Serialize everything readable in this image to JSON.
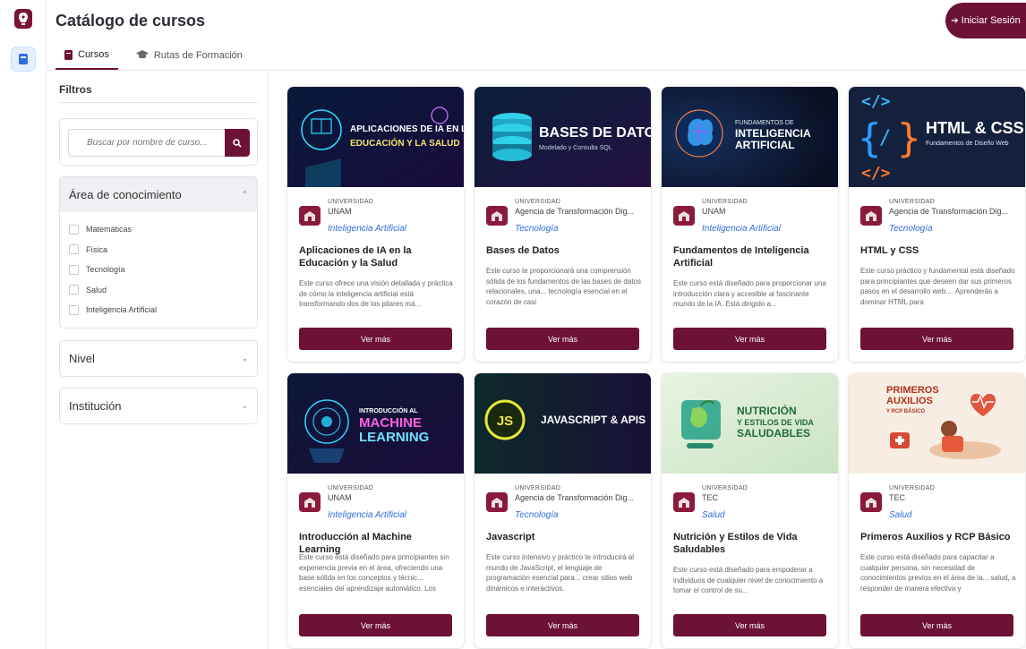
{
  "header": {
    "title": "Catálogo de cursos",
    "login_label": "Iniciar Sesión"
  },
  "tabs": [
    {
      "label": "Cursos",
      "icon": "book-icon",
      "active": true
    },
    {
      "label": "Rutas de Formación",
      "icon": "graduation-cap-icon",
      "active": false
    }
  ],
  "filters": {
    "title": "Filtros",
    "search": {
      "placeholder": "Buscar por nombre de curso...",
      "value": ""
    },
    "sections": [
      {
        "label": "Área de conocimiento",
        "expanded": true,
        "options": [
          "Matemáticas",
          "Física",
          "Tecnología",
          "Salud",
          "Inteligencia Artificial"
        ]
      },
      {
        "label": "Nivel",
        "expanded": false
      },
      {
        "label": "Institución",
        "expanded": false
      }
    ]
  },
  "colors": {
    "brand": "#6d1236",
    "accent_blue": "#2f6ed8"
  },
  "courses": [
    {
      "image_title": "APLICACIONES DE IA EN LA",
      "image_title2": "EDUCACIÓN Y LA SALUD",
      "institution_type": "UNIVERSIDAD",
      "institution": "UNAM",
      "area": "Inteligencia Artificial",
      "title": "Aplicaciones de IA en la Educación y la Salud",
      "description": "Este curso ofrece una visión detallada y práctica de cómo la inteligencia artificial está transformando dos de los pilares má...",
      "button": "Ver más"
    },
    {
      "image_title": "BASES DE DATOS",
      "image_subtitle": "Modelado y Consulta SQL",
      "institution_type": "UNIVERSIDAD",
      "institution": "Agencia de Transformación Dig...",
      "area": "Tecnología",
      "title": "Bases de Datos",
      "description": "Este curso te proporcionará una comprensión sólida de los fundamentos de las bases de datos relacionales, una... tecnología esencial en el corazón de casi",
      "button": "Ver más"
    },
    {
      "image_title": "FUNDAMENTOS DE",
      "image_title2": "INTELIGENCIA",
      "image_title3": "ARTIFICIAL",
      "institution_type": "UNIVERSIDAD",
      "institution": "UNAM",
      "area": "Inteligencia Artificial",
      "title": "Fundamentos de Inteligencia Artificial",
      "description": "Este curso está diseñado para proporcionar una introducción clara y accesible al fascinante mundo de la IA. Está dirigido a...",
      "button": "Ver más"
    },
    {
      "image_title": "HTML & CSS",
      "image_subtitle": "Fundamentos de Diseño Web",
      "institution_type": "UNIVERSIDAD",
      "institution": "Agencia de Transformación Dig...",
      "area": "Tecnología",
      "title": "HTML y CSS",
      "description": "Este curso práctico y fundamental está diseñado para principiantes que deseen dar sus primeros pasos en el desarrollo web.... Aprenderás a dominar HTML para",
      "button": "Ver más"
    },
    {
      "image_title": "INTRODUCCIÓN AL",
      "image_title2": "MACHINE",
      "image_title3": "LEARNING",
      "institution_type": "UNIVERSIDAD",
      "institution": "UNAM",
      "area": "Inteligencia Artificial",
      "title": "Introducción al Machine Learning",
      "description": "Este curso está diseñado para principiantes sin experiencia previa en el área, ofreciendo una base sólida en los conceptos y técnic... esenciales del aprendizaje automático. Los",
      "button": "Ver más"
    },
    {
      "image_title": "JAVASCRIPT & APIS",
      "image_badge": "JS",
      "institution_type": "UNIVERSIDAD",
      "institution": "Agencia de Transformación Dig...",
      "area": "Tecnología",
      "title": "Javascript",
      "description": "Este curso intensivo y práctico te introducirá al mundo de JavaScript, el lenguaje de programación esencial para... crear sitios web dinámicos e interactivos.",
      "button": "Ver más"
    },
    {
      "image_title": "NUTRICIÓN",
      "image_title2": "Y ESTILOS DE VIDA",
      "image_title3": "SALUDABLES",
      "institution_type": "UNIVERSIDAD",
      "institution": "TEC",
      "area": "Salud",
      "title": "Nutrición y Estilos de Vida Saludables",
      "description": "Este curso está diseñado para empoderar a individuos de cualquier nivel de conocimiento a tomar el control de su...",
      "button": "Ver más"
    },
    {
      "image_title": "PRIMEROS",
      "image_title2": "AUXILIOS",
      "image_title3": "Y RCP BÁSICO",
      "institution_type": "UNIVERSIDAD",
      "institution": "TEC",
      "area": "Salud",
      "title": "Primeros Auxilios y RCP Básico",
      "description": "Este curso está diseñado para capacitar a cualquier persona, sin necesidad de conocimientos previos en el área de la... salud, a responder de manera efectiva y",
      "button": "Ver más"
    }
  ]
}
